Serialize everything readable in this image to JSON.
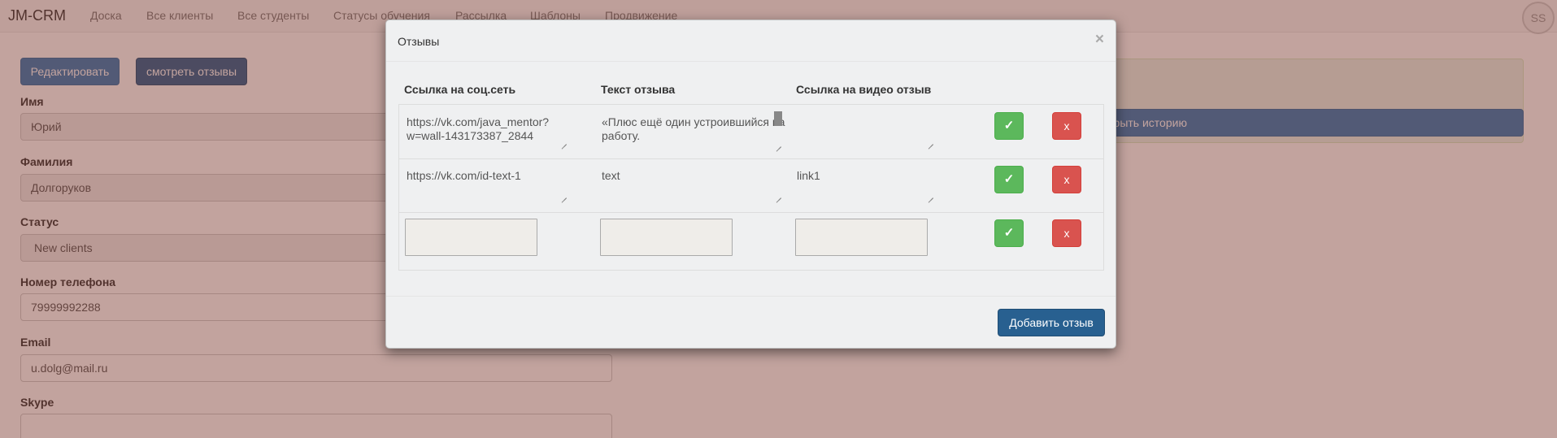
{
  "navbar": {
    "brand": "JM-CRM",
    "items": [
      "Доска",
      "Все клиенты",
      "Все студенты",
      "Статусы обучения",
      "Рассылка",
      "Шаблоны",
      "Продвижение"
    ],
    "avatar": "SS"
  },
  "page": {
    "edit_button": "Редактировать",
    "reviews_button": "смотреть отзывы",
    "fields": [
      {
        "label": "Имя",
        "value": "Юрий"
      },
      {
        "label": "Фамилия",
        "value": "Долгоруков"
      },
      {
        "label": "Статус",
        "value": "New clients"
      },
      {
        "label": "Номер телефона",
        "value": "79999992288"
      },
      {
        "label": "Email",
        "value": "u.dolg@mail.ru"
      },
      {
        "label": "Skype",
        "value": ""
      }
    ],
    "history_button": "ткрыть историю"
  },
  "modal": {
    "title": "Отзывы",
    "close": "×",
    "columns": [
      "Ссылка на соц.сеть",
      "Текст отзыва",
      "Ссылка на видео отзыв"
    ],
    "rows": [
      {
        "link": "https://vk.com/java_mentor?w=wall-143173387_2844",
        "text": "«Плюс ещё один устроившийся на работу.",
        "video": ""
      },
      {
        "link": "https://vk.com/id-text-1",
        "text": "text",
        "video": "link1"
      },
      {
        "link": "",
        "text": "",
        "video": ""
      }
    ],
    "confirm_symbol": "✓",
    "delete_symbol": "x",
    "add_button": "Добавить отзыв"
  },
  "colors": {
    "backdrop": "#783428",
    "primary": "#337ab7",
    "success": "#5cb85c",
    "danger": "#d9534f"
  }
}
